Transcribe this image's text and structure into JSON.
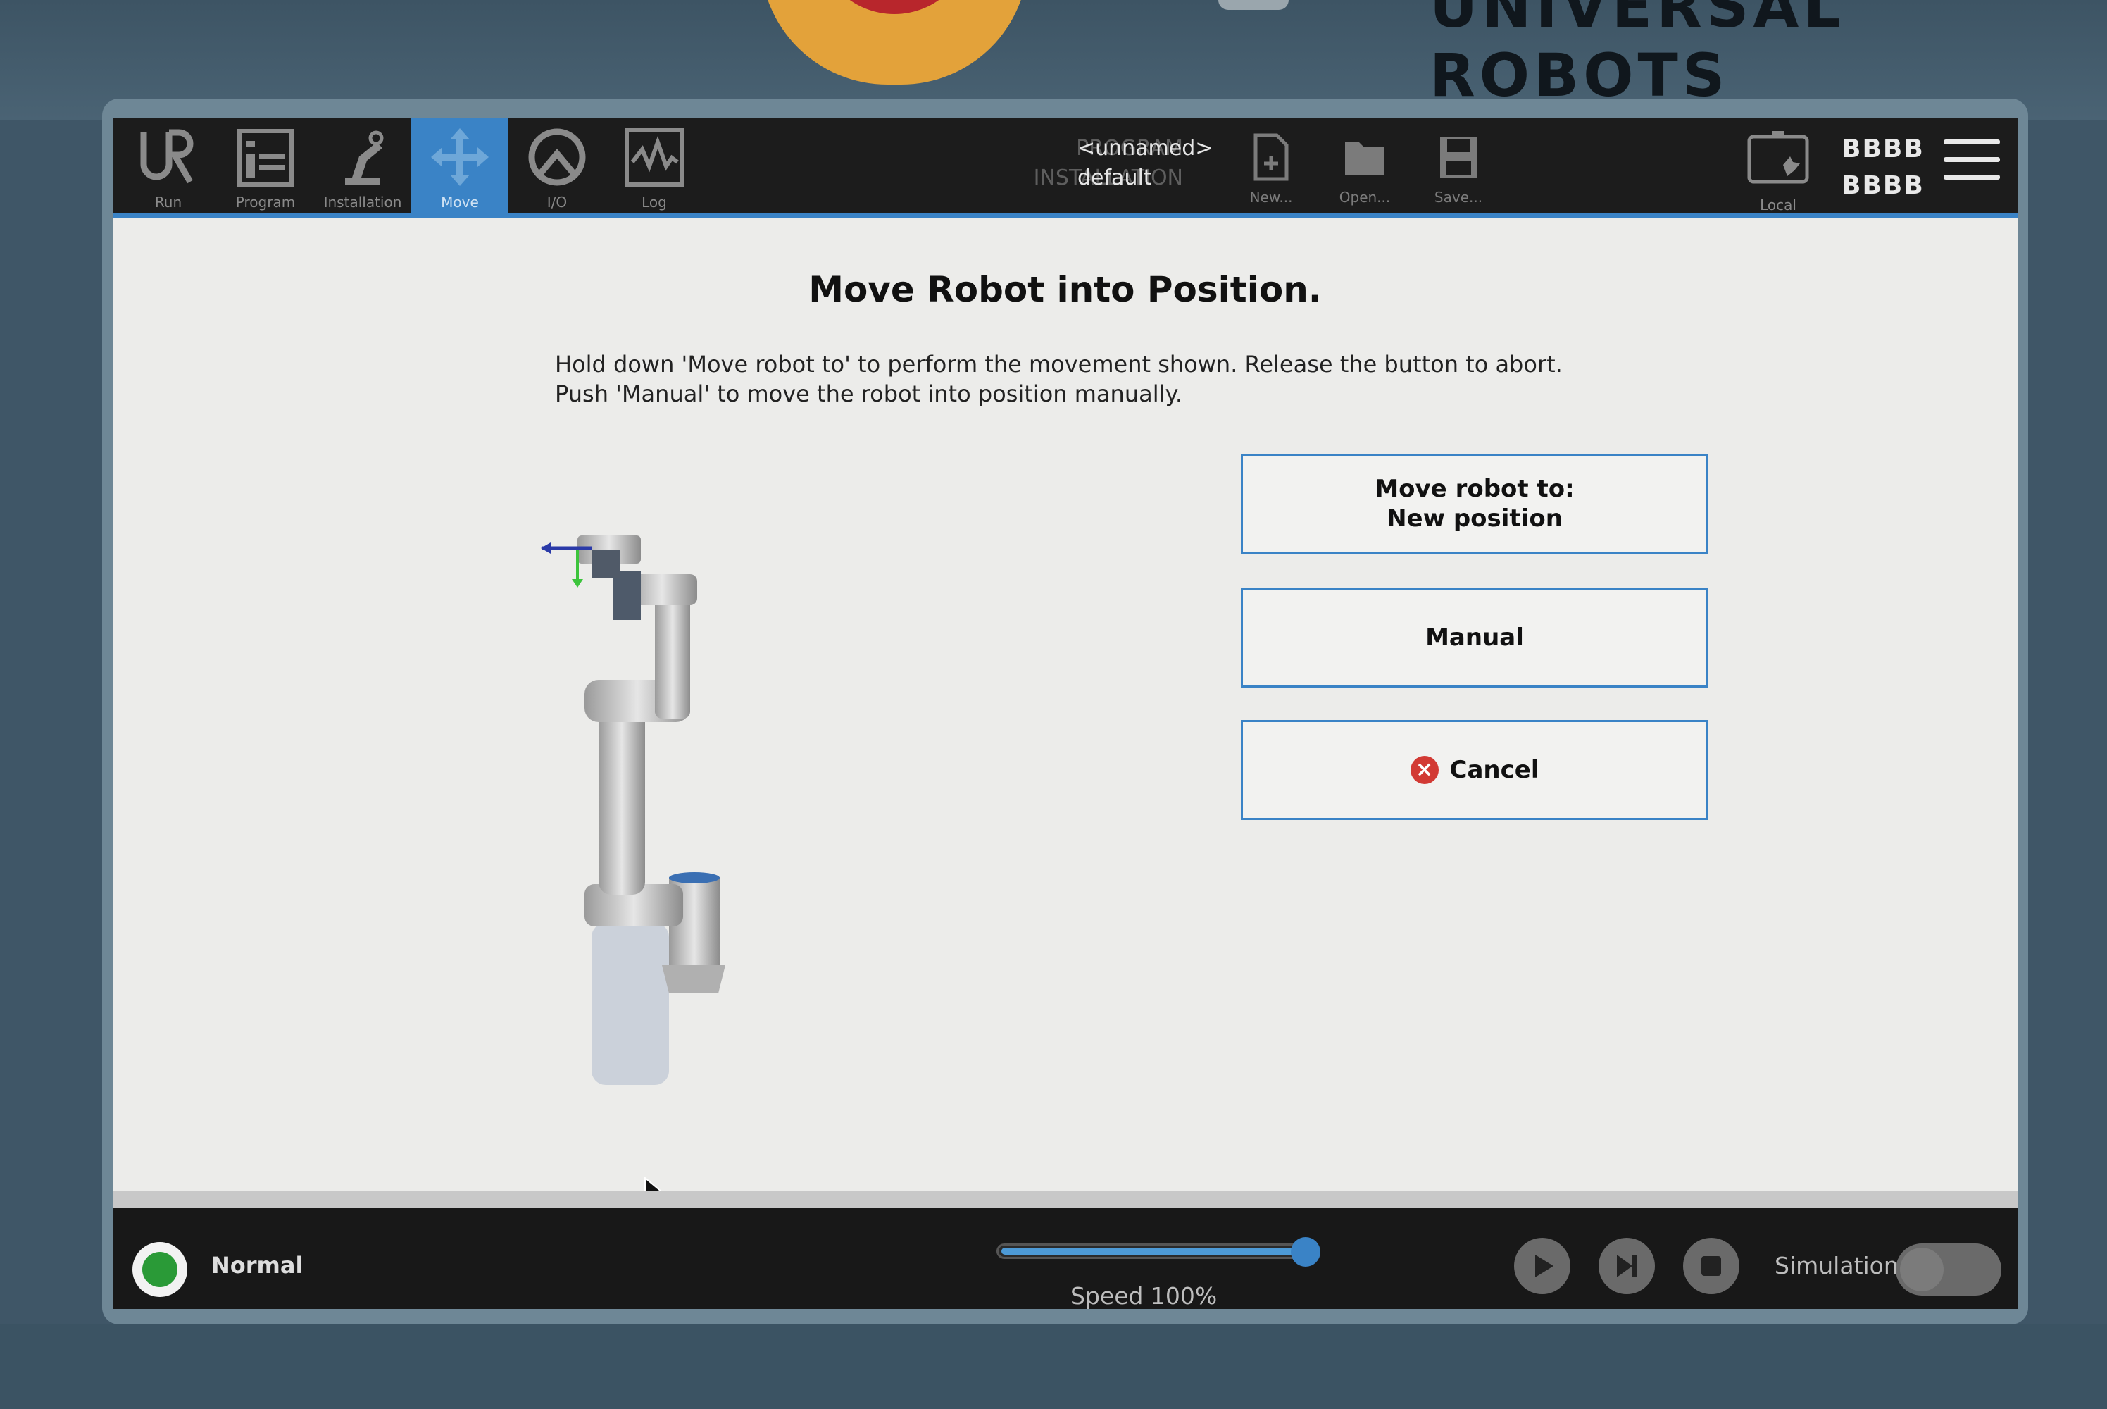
{
  "hardware": {
    "brand": "UNIVERSAL ROBOTS"
  },
  "header": {
    "tabs": [
      {
        "label": "Run",
        "icon": "ur-logo-icon",
        "active": false
      },
      {
        "label": "Program",
        "icon": "program-icon",
        "active": false
      },
      {
        "label": "Installation",
        "icon": "installation-icon",
        "active": false
      },
      {
        "label": "Move",
        "icon": "move-arrows-icon",
        "active": true
      },
      {
        "label": "I/O",
        "icon": "io-icon",
        "active": false
      },
      {
        "label": "Log",
        "icon": "log-waveform-icon",
        "active": false
      }
    ],
    "program_label": "PROGRAM",
    "program_value": "<unnamed>",
    "installation_label": "INSTALLATION",
    "installation_value": "default",
    "file_buttons": [
      {
        "label": "New...",
        "icon": "new-file-icon"
      },
      {
        "label": "Open...",
        "icon": "open-folder-icon"
      },
      {
        "label": "Save...",
        "icon": "save-disk-icon"
      }
    ],
    "local_label": "Local",
    "user_line_1": "BBBB",
    "user_line_2": "BBBB",
    "menu_icon": "hamburger-menu-icon"
  },
  "content": {
    "title": "Move Robot into Position.",
    "instruction_line_1": "Hold down 'Move robot to' to perform the movement shown. Release the button to abort.",
    "instruction_line_2": "Push 'Manual' to move the robot into position manually.",
    "move_button_line_1": "Move robot to:",
    "move_button_line_2": "New position",
    "manual_button": "Manual",
    "cancel_button": "Cancel"
  },
  "footer": {
    "status": "Normal",
    "status_color": "#2a9a37",
    "speed_label": "Speed 100%",
    "speed_percent": 100,
    "simulation_label": "Simulation",
    "simulation_on": false
  },
  "colors": {
    "accent": "#3a83c6",
    "cancel": "#d23a34"
  }
}
